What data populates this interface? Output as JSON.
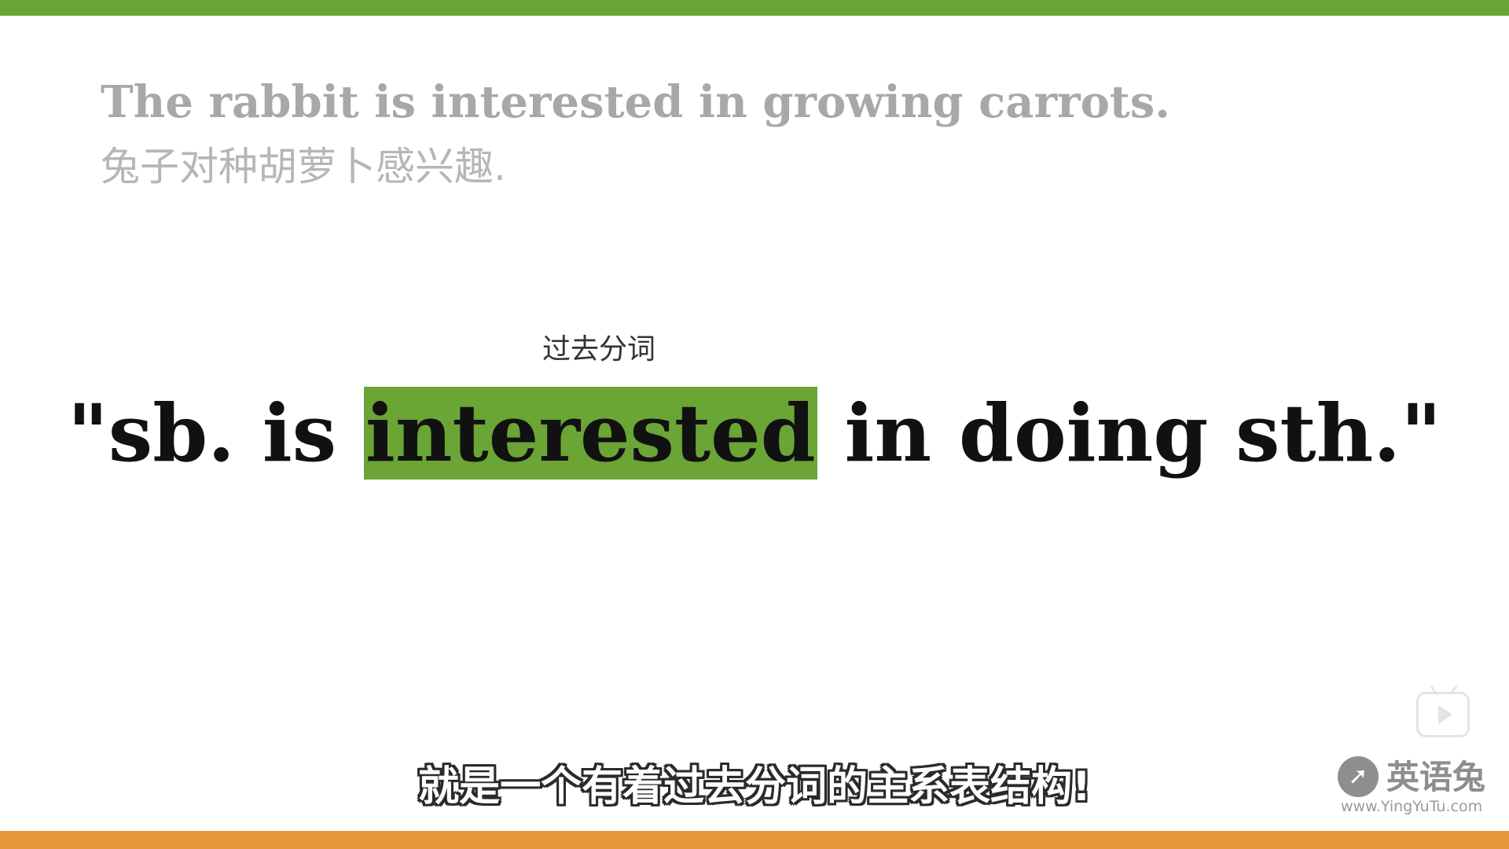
{
  "slide": {
    "example_english": "The rabbit is interested in growing carrots.",
    "example_chinese": "兔子对种胡萝卜感兴趣.",
    "annotation": "过去分词",
    "pattern": {
      "before": "\"sb. is ",
      "highlight": "interested",
      "after": " in doing sth.\""
    }
  },
  "subtitle": "就是一个有着过去分词的主系表结构!",
  "watermark": {
    "name": "英语兔",
    "url": "www.YingYuTu.com",
    "logo_icon": "rabbit-logo-icon"
  },
  "player": {
    "tv_icon": "tv-play-icon"
  },
  "colors": {
    "accent_green": "#6aa536",
    "accent_orange": "#e8963a",
    "faded_text": "#a8a8a8"
  }
}
